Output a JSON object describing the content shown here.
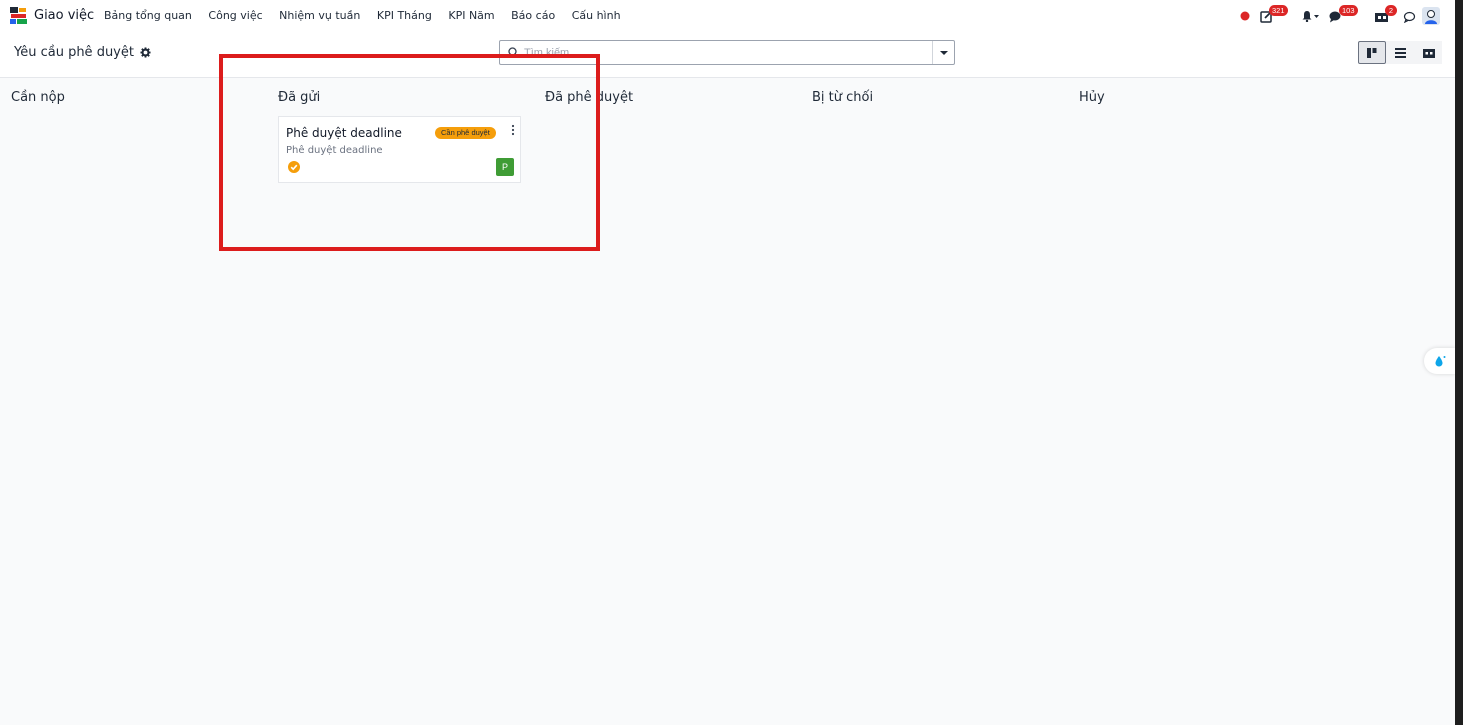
{
  "navbar": {
    "app_name": "Giao việc",
    "menu": [
      "Bảng tổng quan",
      "Công việc",
      "Nhiệm vụ tuần",
      "KPI Tháng",
      "KPI Năm",
      "Báo cáo",
      "Cấu hình"
    ],
    "badges": {
      "activities": "321",
      "messages": "103",
      "approvals": "2"
    }
  },
  "control_panel": {
    "breadcrumb": "Yêu cầu phê duyệt",
    "search_placeholder": "Tìm kiếm..."
  },
  "kanban": {
    "columns": [
      {
        "title": "Cần nộp"
      },
      {
        "title": "Đã gửi"
      },
      {
        "title": "Đã phê duyệt"
      },
      {
        "title": "Bị từ chối"
      },
      {
        "title": "Hủy"
      }
    ],
    "card": {
      "title": "Phê duyệt deadline",
      "tag": "Cần phê duyệt",
      "subtitle": "Phê duyệt deadline",
      "avatar": "P"
    }
  },
  "colors": {
    "accent_red": "#dc2626",
    "tag_orange": "#f59e0b",
    "avatar_green": "#3f9c35",
    "highlight_red": "#dc1c1c"
  },
  "icons": [
    "app-logo-icon",
    "gear-icon",
    "search-icon",
    "kanban-view-icon",
    "list-view-icon",
    "activity-view-icon",
    "status-dot-icon",
    "edit-icon",
    "bell-icon",
    "chat-icon",
    "approval-icon",
    "discuss-icon",
    "user-avatar-icon",
    "check-circle-icon",
    "kebab-menu-icon",
    "assistant-widget-icon"
  ]
}
